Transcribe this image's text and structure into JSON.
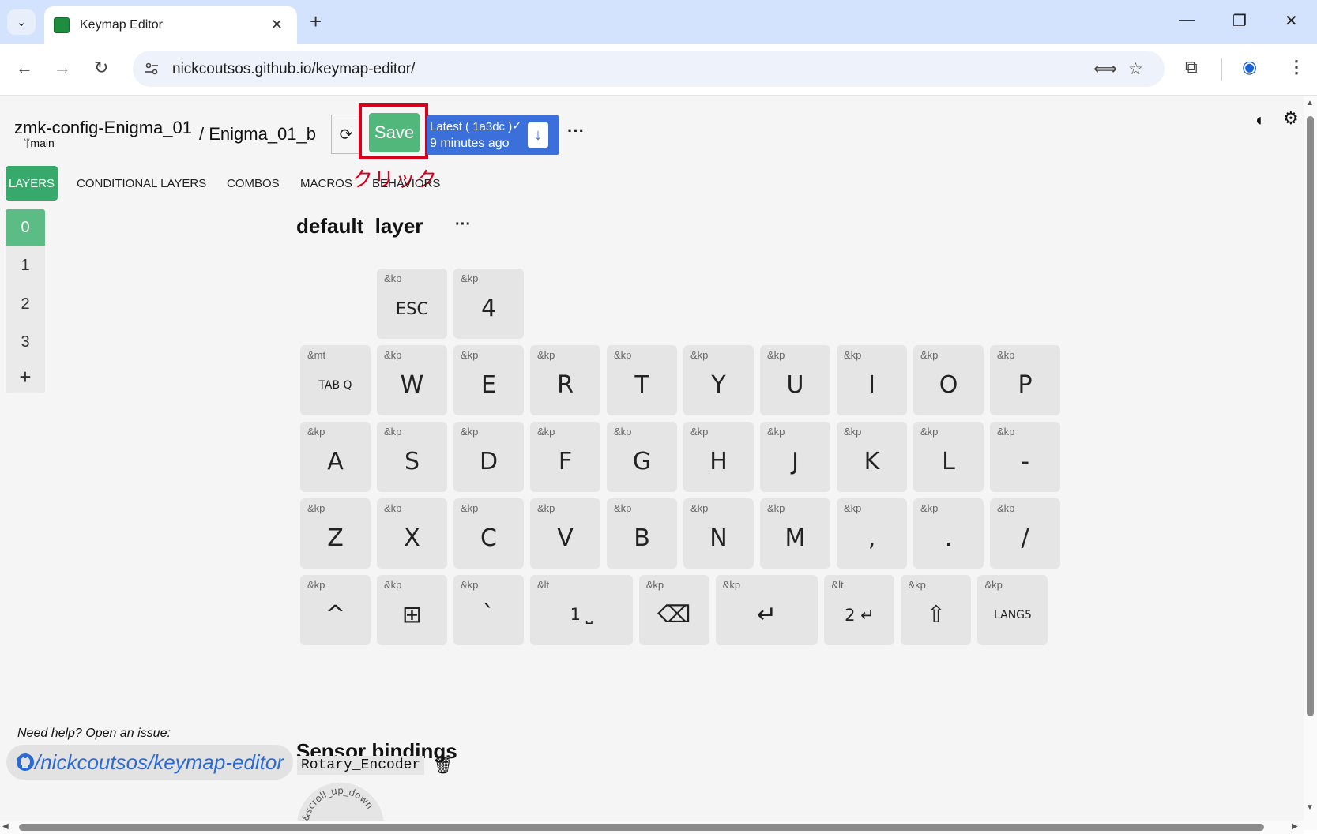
{
  "browser": {
    "tab_title": "Keymap Editor",
    "url": "nickcoutsos.github.io/keymap-editor/"
  },
  "header": {
    "repo": "zmk-config-Enigma_01",
    "branch": "main",
    "keyboard": "/ Enigma_01_b",
    "save_label": "Save",
    "commit_line1": "Latest ( 1a3dc )",
    "commit_line2": "9 minutes ago",
    "annotation": "クリック"
  },
  "nav_tabs": [
    "LAYERS",
    "CONDITIONAL LAYERS",
    "COMBOS",
    "MACROS",
    "BEHAVIORS"
  ],
  "layers": [
    "0",
    "1",
    "2",
    "3"
  ],
  "layer_title": "default_layer",
  "keys": [
    {
      "beh": "&kp",
      "val": "ESC"
    },
    {
      "beh": "&kp",
      "val": "4"
    },
    {
      "beh": "&mt",
      "val": "TAB Q"
    },
    {
      "beh": "&kp",
      "val": "W"
    },
    {
      "beh": "&kp",
      "val": "E"
    },
    {
      "beh": "&kp",
      "val": "R"
    },
    {
      "beh": "&kp",
      "val": "T"
    },
    {
      "beh": "&kp",
      "val": "Y"
    },
    {
      "beh": "&kp",
      "val": "U"
    },
    {
      "beh": "&kp",
      "val": "I"
    },
    {
      "beh": "&kp",
      "val": "O"
    },
    {
      "beh": "&kp",
      "val": "P"
    },
    {
      "beh": "&kp",
      "val": "A"
    },
    {
      "beh": "&kp",
      "val": "S"
    },
    {
      "beh": "&kp",
      "val": "D"
    },
    {
      "beh": "&kp",
      "val": "F"
    },
    {
      "beh": "&kp",
      "val": "G"
    },
    {
      "beh": "&kp",
      "val": "H"
    },
    {
      "beh": "&kp",
      "val": "J"
    },
    {
      "beh": "&kp",
      "val": "K"
    },
    {
      "beh": "&kp",
      "val": "L"
    },
    {
      "beh": "&kp",
      "val": "-"
    },
    {
      "beh": "&kp",
      "val": "Z"
    },
    {
      "beh": "&kp",
      "val": "X"
    },
    {
      "beh": "&kp",
      "val": "C"
    },
    {
      "beh": "&kp",
      "val": "V"
    },
    {
      "beh": "&kp",
      "val": "B"
    },
    {
      "beh": "&kp",
      "val": "N"
    },
    {
      "beh": "&kp",
      "val": "M"
    },
    {
      "beh": "&kp",
      "val": ","
    },
    {
      "beh": "&kp",
      "val": "."
    },
    {
      "beh": "&kp",
      "val": "/"
    },
    {
      "beh": "&kp",
      "val": "^"
    },
    {
      "beh": "&kp",
      "val": "⊞",
      "icon": "windows-icon"
    },
    {
      "beh": "&kp",
      "val": "`"
    },
    {
      "beh": "&lt",
      "val": "1 ⎵"
    },
    {
      "beh": "&kp",
      "val": "⌫",
      "icon": "backspace-icon"
    },
    {
      "beh": "&kp",
      "val": "↵",
      "icon": "enter-icon"
    },
    {
      "beh": "&lt",
      "val": "2 ↵"
    },
    {
      "beh": "&kp",
      "val": "⇧",
      "icon": "shift-icon"
    },
    {
      "beh": "&kp",
      "val": "LANG5"
    }
  ],
  "sensor": {
    "title": "Sensor bindings",
    "name": "Rotary_Encoder",
    "binding": "&scroll_up_down"
  },
  "footer": {
    "help": "Need help? Open an issue:",
    "link": "/nickcoutsos/keymap-editor"
  }
}
